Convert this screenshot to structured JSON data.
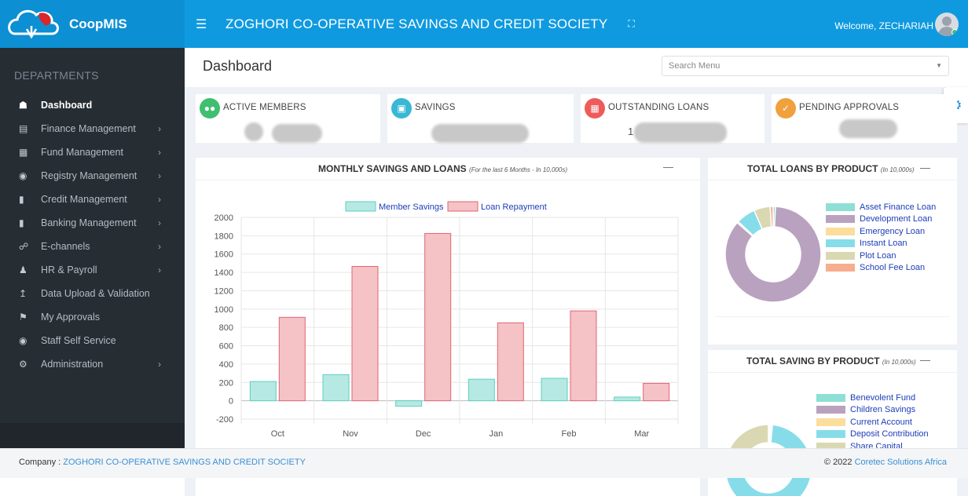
{
  "header": {
    "brand": "CoopMIS",
    "org_title": "ZOGHORI CO-OPERATIVE SAVINGS AND CREDIT SOCIETY",
    "welcome": "Welcome, ZECHARIAH",
    "menu_icon": "hamburger-icon",
    "expand_icon": "fullscreen-icon"
  },
  "sidebar": {
    "section": "DEPARTMENTS",
    "items": [
      {
        "label": "Dashboard",
        "icon": "home-icon",
        "chevron": false,
        "active": true
      },
      {
        "label": "Finance Management",
        "icon": "wallet-icon",
        "chevron": true
      },
      {
        "label": "Fund Management",
        "icon": "briefcase-icon",
        "chevron": true
      },
      {
        "label": "Registry Management",
        "icon": "user-circle-icon",
        "chevron": true
      },
      {
        "label": "Credit Management",
        "icon": "book-icon",
        "chevron": true
      },
      {
        "label": "Banking Management",
        "icon": "book-icon",
        "chevron": true
      },
      {
        "label": "E-channels",
        "icon": "cart-icon",
        "chevron": true
      },
      {
        "label": "HR & Payroll",
        "icon": "person-icon",
        "chevron": true
      },
      {
        "label": "Data Upload & Validation",
        "icon": "upload-icon",
        "chevron": false
      },
      {
        "label": "My Approvals",
        "icon": "flag-icon",
        "chevron": false
      },
      {
        "label": "Staff Self Service",
        "icon": "user-circle-icon",
        "chevron": false
      },
      {
        "label": "Administration",
        "icon": "cog-icon",
        "chevron": true
      }
    ]
  },
  "page": {
    "title": "Dashboard",
    "search_placeholder": "Search Menu"
  },
  "stats": [
    {
      "label": "ACTIVE MEMBERS",
      "color": "#3fbf6f",
      "icon": "users-icon"
    },
    {
      "label": "SAVINGS",
      "color": "#38b8d4",
      "icon": "money-icon"
    },
    {
      "label": "OUTSTANDING LOANS",
      "color": "#ee5b5b",
      "icon": "calculator-icon",
      "visible_digit": "1"
    },
    {
      "label": "PENDING APPROVALS",
      "color": "#f0a03c",
      "icon": "check-icon"
    }
  ],
  "panels": {
    "monthly": {
      "title": "MONTHLY SAVINGS AND LOANS",
      "subtitle": "(For the last 6 Months - In 10,000s)"
    },
    "loans": {
      "title": "TOTAL LOANS BY PRODUCT",
      "subtitle": "(In 10,000s)"
    },
    "saving": {
      "title": "TOTAL SAVING BY PRODUCT",
      "subtitle": "(In 10,000s)"
    }
  },
  "chart_data": [
    {
      "type": "bar",
      "title": "MONTHLY SAVINGS AND LOANS",
      "categories": [
        "Oct",
        "Nov",
        "Dec",
        "Jan",
        "Feb",
        "Mar"
      ],
      "ylim": [
        -200,
        2000
      ],
      "yticks": [
        -200,
        0,
        200,
        400,
        600,
        800,
        1000,
        1200,
        1400,
        1600,
        1800,
        2000
      ],
      "grid": true,
      "legend": "top",
      "series": [
        {
          "name": "Member Savings",
          "values": [
            210,
            285,
            -60,
            235,
            245,
            40
          ],
          "fill": "#b6e9e3",
          "stroke": "#5ccfc0"
        },
        {
          "name": "Loan Repayment",
          "values": [
            910,
            1465,
            1825,
            850,
            980,
            190
          ],
          "fill": "#f5c2c6",
          "stroke": "#e06670"
        }
      ]
    },
    {
      "type": "pie",
      "title": "TOTAL LOANS BY PRODUCT",
      "labels": [
        "Asset Finance Loan",
        "Development Loan",
        "Emergency Loan",
        "Instant Loan",
        "Plot Loan",
        "School Fee Loan"
      ],
      "values": [
        0.8,
        85.7,
        0.5,
        6.5,
        5.5,
        1.0
      ],
      "colors": [
        "#8edfd6",
        "#b9a2bf",
        "#fbdd9c",
        "#86dde9",
        "#dad8b2",
        "#f7ae8f"
      ],
      "legend": "right"
    },
    {
      "type": "pie",
      "title": "TOTAL SAVING BY PRODUCT",
      "labels": [
        "Benevolent Fund",
        "Children Savings",
        "Current Account",
        "Deposit Contribution",
        "Share Capital"
      ],
      "values": [
        0.5,
        0.5,
        0.5,
        72,
        26.5
      ],
      "colors": [
        "#8edfd6",
        "#b9a2bf",
        "#fbdd9c",
        "#86dde9",
        "#dad8b2"
      ],
      "legend": "right"
    }
  ],
  "footer": {
    "company_label": "Company : ",
    "company_name": "ZOGHORI CO-OPERATIVE SAVINGS AND CREDIT SOCIETY",
    "copyright": "© 2022 ",
    "vendor": "Coretec Solutions Africa"
  }
}
